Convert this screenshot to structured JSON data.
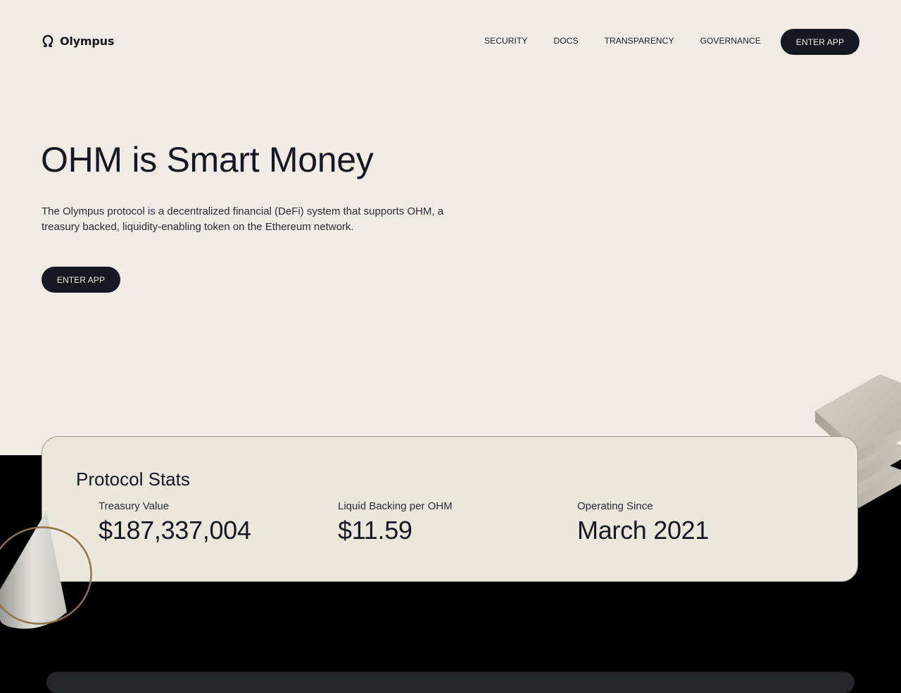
{
  "brand": {
    "name": "Olympus",
    "logo_icon": "omega-icon"
  },
  "nav": {
    "items": [
      "SECURITY",
      "DOCS",
      "TRANSPARENCY",
      "GOVERNANCE"
    ],
    "cta": "ENTER APP"
  },
  "hero": {
    "title": "OHM is Smart Money",
    "description": "The Olympus protocol is a decentralized financial (DeFi) system that supports OHM, a treasury backed, liquidity-enabling token on the Ethereum network.",
    "cta": "ENTER APP"
  },
  "stats": {
    "title": "Protocol Stats",
    "items": [
      {
        "label": "Treasury Value",
        "value": "$187,337,004"
      },
      {
        "label": "Liquid Backing per OHM",
        "value": "$11.59"
      },
      {
        "label": "Operating Since",
        "value": "March 2021"
      }
    ]
  },
  "colors": {
    "background": "#f0ece5",
    "dark": "#171922",
    "card": "#ece7dd",
    "footer": "#000000"
  }
}
